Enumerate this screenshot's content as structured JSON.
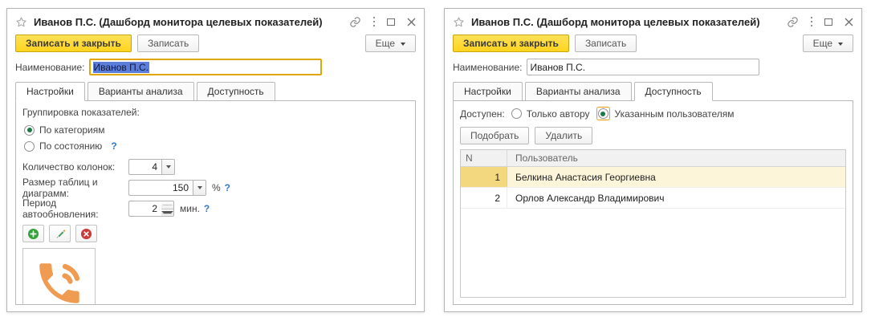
{
  "shared": {
    "title": "Иванов П.С. (Дашборд монитора целевых показателей)",
    "save_close_label": "Записать и закрыть",
    "save_label": "Записать",
    "more_label": "Еще",
    "name_label": "Наименование:",
    "name_value": "Иванов П.С.",
    "tabs": [
      "Настройки",
      "Варианты анализа",
      "Доступность"
    ],
    "help_glyph": "?"
  },
  "left_window": {
    "active_tab": "Настройки",
    "settings": {
      "grouping_label": "Группировка показателей:",
      "radio_by_category": "По категориям",
      "radio_by_state": "По состоянию",
      "columns_label": "Количество колонок:",
      "columns_value": "4",
      "size_label": "Размер таблиц и диаграмм:",
      "size_value": "150",
      "size_unit": "%",
      "refresh_label": "Период автообновления:",
      "refresh_value": "2",
      "refresh_unit": "мин."
    },
    "image": "phone-call-icon"
  },
  "right_window": {
    "active_tab": "Доступность",
    "access": {
      "available_label": "Доступен:",
      "radio_author_only": "Только автору",
      "radio_specified_users": "Указанным пользователям",
      "pick_label": "Подобрать",
      "delete_label": "Удалить",
      "table_headers": [
        "N",
        "Пользователь"
      ],
      "rows": [
        {
          "n": "1",
          "user": "Белкина Анастасия Георгиевна"
        },
        {
          "n": "2",
          "user": "Орлов Александр Владимирович"
        }
      ],
      "selected_row_index": 0
    }
  },
  "colors": {
    "accent-yellow": "#FFD41E",
    "focus-border": "#E2A600",
    "selection-blue": "#5B7EDB",
    "row-highlight": "#FCF5DA",
    "cell-highlight": "#F3D87F",
    "help-blue": "#2E79D0",
    "radio-green": "#1E7A44",
    "phone-orange": "#EF9B51"
  }
}
